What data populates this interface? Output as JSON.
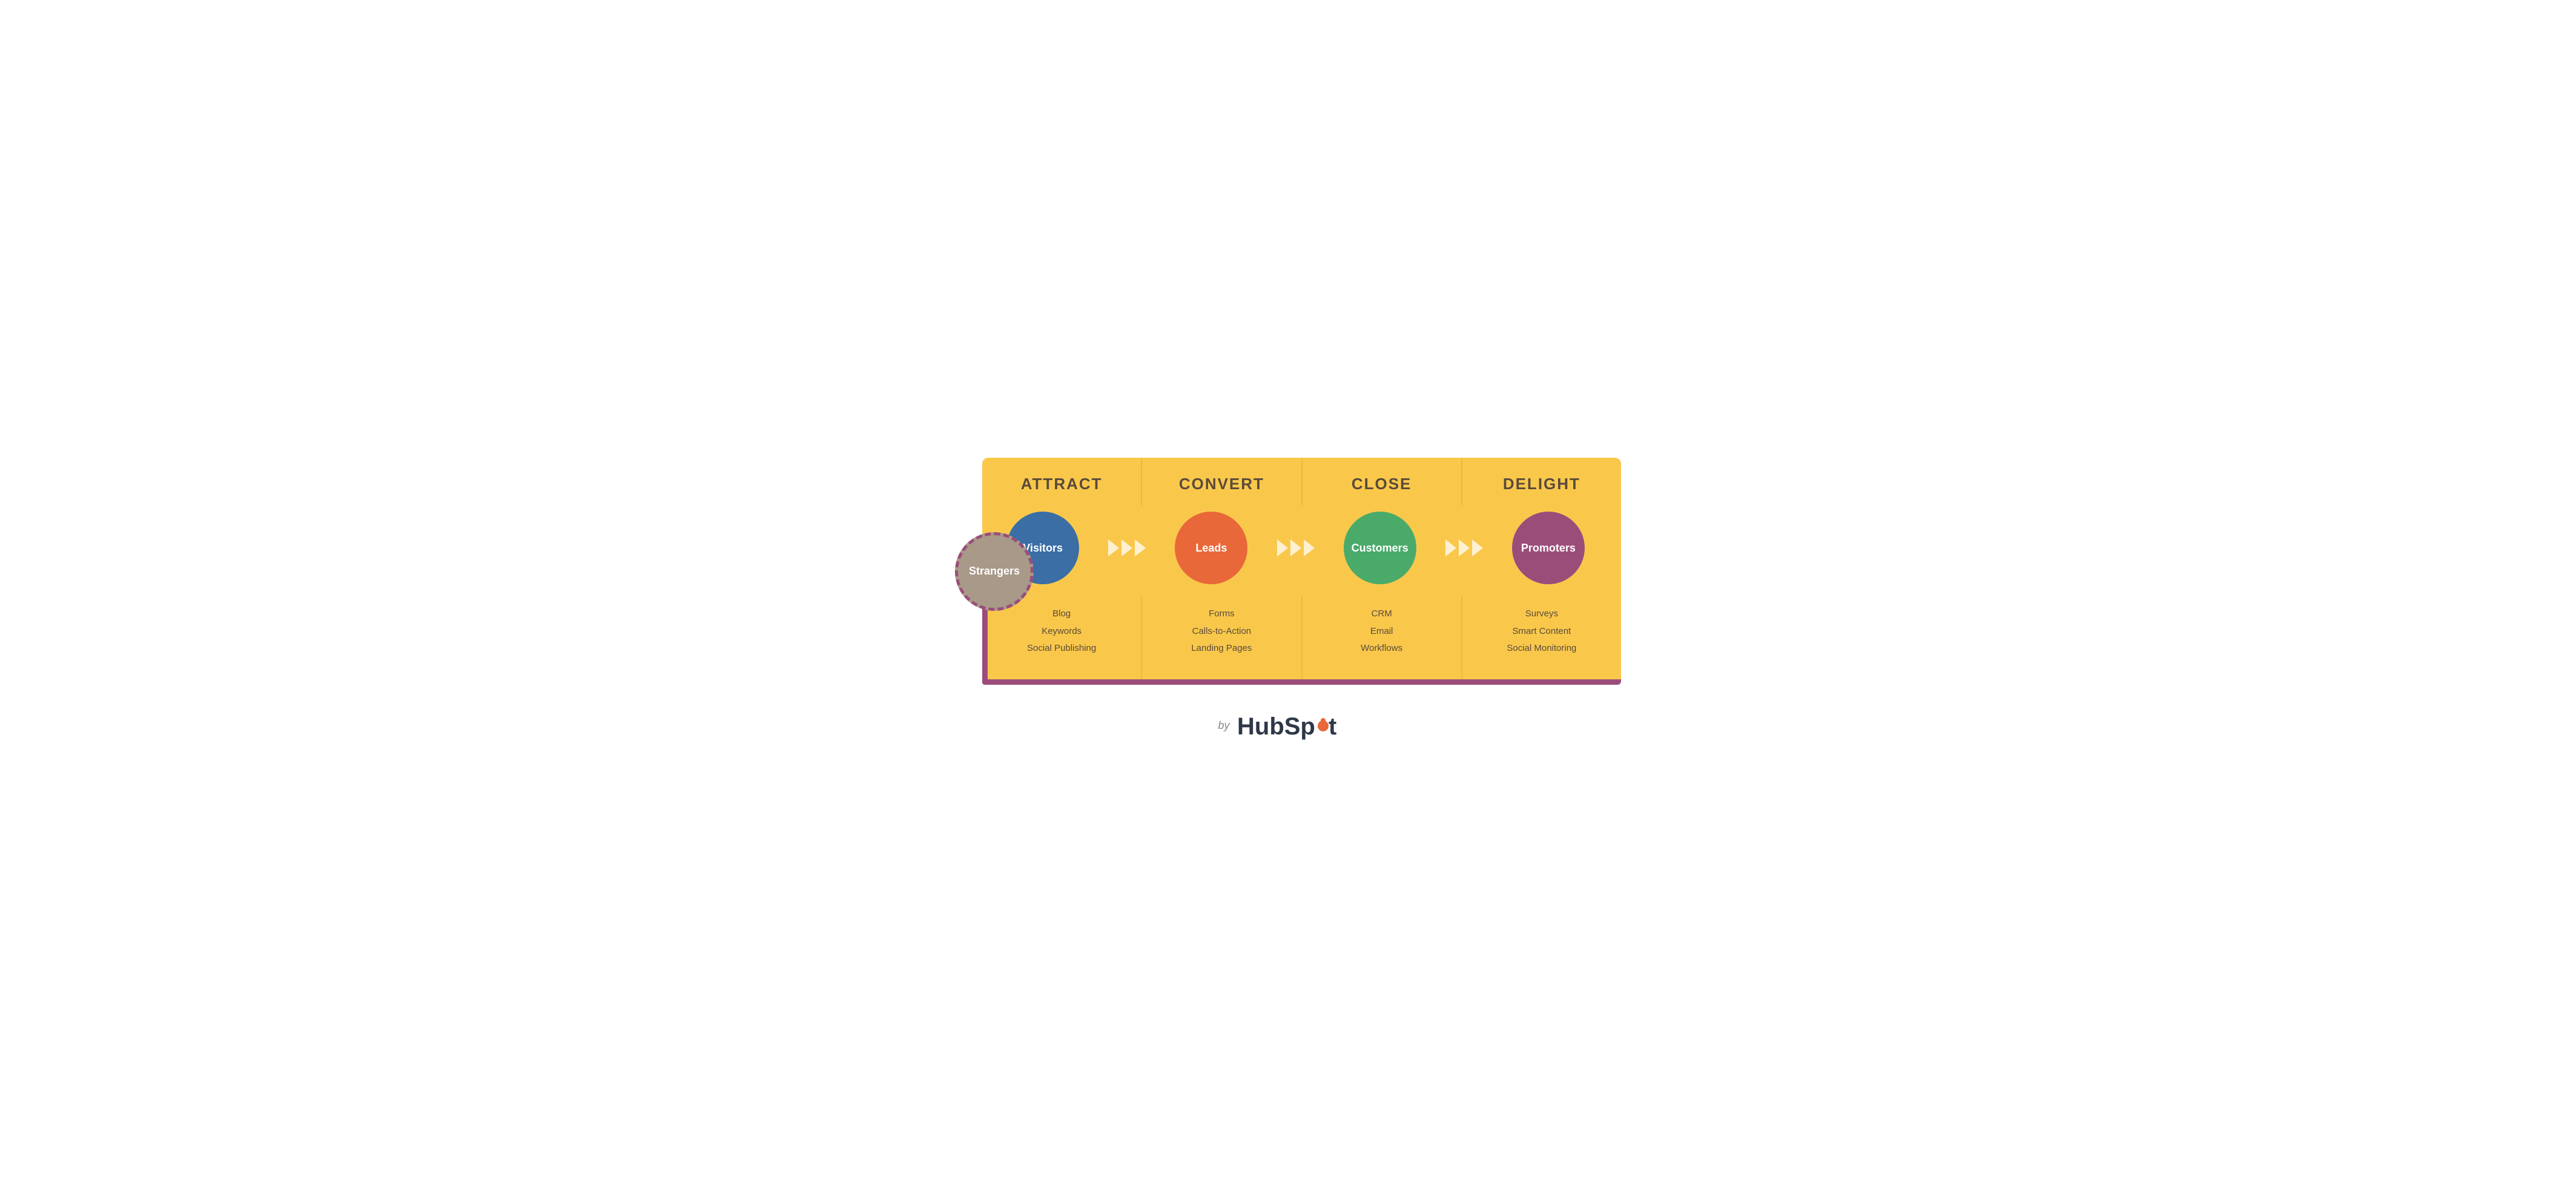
{
  "diagram": {
    "stages": [
      {
        "id": "attract",
        "header": "ATTRACT",
        "circleLabel": "Visitors",
        "circleColor": "circle-blue",
        "tools": [
          "Blog",
          "Keywords",
          "Social Publishing"
        ]
      },
      {
        "id": "convert",
        "header": "CONVERT",
        "circleLabel": "Leads",
        "circleColor": "circle-orange",
        "tools": [
          "Forms",
          "Calls-to-Action",
          "Landing Pages"
        ]
      },
      {
        "id": "close",
        "header": "CLOSE",
        "circleLabel": "Customers",
        "circleColor": "circle-green",
        "tools": [
          "CRM",
          "Email",
          "Workflows"
        ]
      },
      {
        "id": "delight",
        "header": "DELIGHT",
        "circleLabel": "Promoters",
        "circleColor": "circle-purple",
        "tools": [
          "Surveys",
          "Smart Content",
          "Social Monitoring"
        ]
      }
    ],
    "strangers": {
      "label": "Strangers"
    }
  },
  "footer": {
    "by": "by",
    "brand": "HubSpot"
  }
}
